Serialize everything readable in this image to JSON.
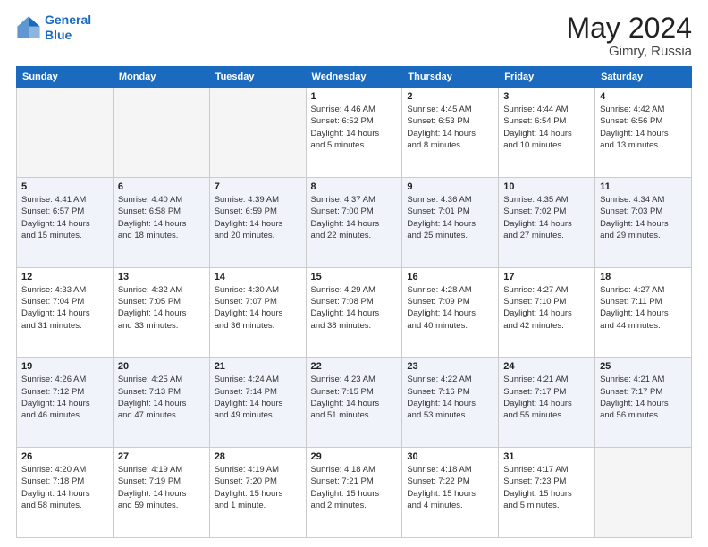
{
  "header": {
    "logo_line1": "General",
    "logo_line2": "Blue",
    "main_title": "May 2024",
    "sub_title": "Gimry, Russia"
  },
  "days_of_week": [
    "Sunday",
    "Monday",
    "Tuesday",
    "Wednesday",
    "Thursday",
    "Friday",
    "Saturday"
  ],
  "weeks": [
    [
      {
        "day": "",
        "empty": true
      },
      {
        "day": "",
        "empty": true
      },
      {
        "day": "",
        "empty": true
      },
      {
        "day": "1",
        "info": "Sunrise: 4:46 AM\nSunset: 6:52 PM\nDaylight: 14 hours\nand 5 minutes."
      },
      {
        "day": "2",
        "info": "Sunrise: 4:45 AM\nSunset: 6:53 PM\nDaylight: 14 hours\nand 8 minutes."
      },
      {
        "day": "3",
        "info": "Sunrise: 4:44 AM\nSunset: 6:54 PM\nDaylight: 14 hours\nand 10 minutes."
      },
      {
        "day": "4",
        "info": "Sunrise: 4:42 AM\nSunset: 6:56 PM\nDaylight: 14 hours\nand 13 minutes."
      }
    ],
    [
      {
        "day": "5",
        "info": "Sunrise: 4:41 AM\nSunset: 6:57 PM\nDaylight: 14 hours\nand 15 minutes."
      },
      {
        "day": "6",
        "info": "Sunrise: 4:40 AM\nSunset: 6:58 PM\nDaylight: 14 hours\nand 18 minutes."
      },
      {
        "day": "7",
        "info": "Sunrise: 4:39 AM\nSunset: 6:59 PM\nDaylight: 14 hours\nand 20 minutes."
      },
      {
        "day": "8",
        "info": "Sunrise: 4:37 AM\nSunset: 7:00 PM\nDaylight: 14 hours\nand 22 minutes."
      },
      {
        "day": "9",
        "info": "Sunrise: 4:36 AM\nSunset: 7:01 PM\nDaylight: 14 hours\nand 25 minutes."
      },
      {
        "day": "10",
        "info": "Sunrise: 4:35 AM\nSunset: 7:02 PM\nDaylight: 14 hours\nand 27 minutes."
      },
      {
        "day": "11",
        "info": "Sunrise: 4:34 AM\nSunset: 7:03 PM\nDaylight: 14 hours\nand 29 minutes."
      }
    ],
    [
      {
        "day": "12",
        "info": "Sunrise: 4:33 AM\nSunset: 7:04 PM\nDaylight: 14 hours\nand 31 minutes."
      },
      {
        "day": "13",
        "info": "Sunrise: 4:32 AM\nSunset: 7:05 PM\nDaylight: 14 hours\nand 33 minutes."
      },
      {
        "day": "14",
        "info": "Sunrise: 4:30 AM\nSunset: 7:07 PM\nDaylight: 14 hours\nand 36 minutes."
      },
      {
        "day": "15",
        "info": "Sunrise: 4:29 AM\nSunset: 7:08 PM\nDaylight: 14 hours\nand 38 minutes."
      },
      {
        "day": "16",
        "info": "Sunrise: 4:28 AM\nSunset: 7:09 PM\nDaylight: 14 hours\nand 40 minutes."
      },
      {
        "day": "17",
        "info": "Sunrise: 4:27 AM\nSunset: 7:10 PM\nDaylight: 14 hours\nand 42 minutes."
      },
      {
        "day": "18",
        "info": "Sunrise: 4:27 AM\nSunset: 7:11 PM\nDaylight: 14 hours\nand 44 minutes."
      }
    ],
    [
      {
        "day": "19",
        "info": "Sunrise: 4:26 AM\nSunset: 7:12 PM\nDaylight: 14 hours\nand 46 minutes."
      },
      {
        "day": "20",
        "info": "Sunrise: 4:25 AM\nSunset: 7:13 PM\nDaylight: 14 hours\nand 47 minutes."
      },
      {
        "day": "21",
        "info": "Sunrise: 4:24 AM\nSunset: 7:14 PM\nDaylight: 14 hours\nand 49 minutes."
      },
      {
        "day": "22",
        "info": "Sunrise: 4:23 AM\nSunset: 7:15 PM\nDaylight: 14 hours\nand 51 minutes."
      },
      {
        "day": "23",
        "info": "Sunrise: 4:22 AM\nSunset: 7:16 PM\nDaylight: 14 hours\nand 53 minutes."
      },
      {
        "day": "24",
        "info": "Sunrise: 4:21 AM\nSunset: 7:17 PM\nDaylight: 14 hours\nand 55 minutes."
      },
      {
        "day": "25",
        "info": "Sunrise: 4:21 AM\nSunset: 7:17 PM\nDaylight: 14 hours\nand 56 minutes."
      }
    ],
    [
      {
        "day": "26",
        "info": "Sunrise: 4:20 AM\nSunset: 7:18 PM\nDaylight: 14 hours\nand 58 minutes."
      },
      {
        "day": "27",
        "info": "Sunrise: 4:19 AM\nSunset: 7:19 PM\nDaylight: 14 hours\nand 59 minutes."
      },
      {
        "day": "28",
        "info": "Sunrise: 4:19 AM\nSunset: 7:20 PM\nDaylight: 15 hours\nand 1 minute."
      },
      {
        "day": "29",
        "info": "Sunrise: 4:18 AM\nSunset: 7:21 PM\nDaylight: 15 hours\nand 2 minutes."
      },
      {
        "day": "30",
        "info": "Sunrise: 4:18 AM\nSunset: 7:22 PM\nDaylight: 15 hours\nand 4 minutes."
      },
      {
        "day": "31",
        "info": "Sunrise: 4:17 AM\nSunset: 7:23 PM\nDaylight: 15 hours\nand 5 minutes."
      },
      {
        "day": "",
        "empty": true
      }
    ]
  ]
}
